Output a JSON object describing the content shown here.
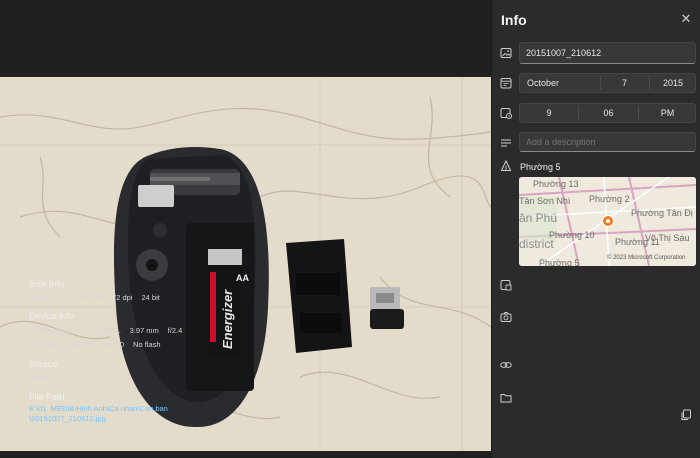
{
  "panel": {
    "title": "Info",
    "filename": "20151007_210612",
    "date": {
      "month": "October",
      "day": "7",
      "year": "2015"
    },
    "time": {
      "hour": "9",
      "minute": "06",
      "ampm": "PM"
    },
    "description_placeholder": "Add a description",
    "location": "Phường 5",
    "map": {
      "labels": [
        "Phường 13",
        "Tân Sơn Nhì",
        "Phường 2",
        "Phường Tân Đị",
        "ân Phú",
        "Phường 10",
        "Phường 11",
        "Võ Thị Sáu",
        "district",
        "Phường 5"
      ],
      "copyright": "© 2023 Microsoft Corporation"
    },
    "size_info": {
      "label": "Size Info",
      "dims": "4160 x 3120",
      "size": "4.1 MB",
      "dpi": "72 dpi",
      "bits": "24 bit"
    },
    "device_info": {
      "label": "Device Info",
      "row1": [
        "LG Electronics",
        "LG-F320L",
        "3.97 mm",
        "f/2.4"
      ],
      "row2": [
        "1/15 sec",
        "ISO 300",
        "EXP 0",
        "No flash"
      ]
    },
    "source": {
      "label": "Source",
      "value": "This PC"
    },
    "file_path": {
      "label": "File Path",
      "line1": "E:\\01. MEDIA\\Hinh Anh\\Ca nhan\\Can ban",
      "line2": "\\20151007_210612.jpg"
    }
  },
  "photo": {
    "battery_brand": "Energizer",
    "battery_size": "AA"
  },
  "colors": {
    "accent": "#79c4ff",
    "pin": "#f07c1f",
    "panel_bg": "#2b2b2b"
  }
}
